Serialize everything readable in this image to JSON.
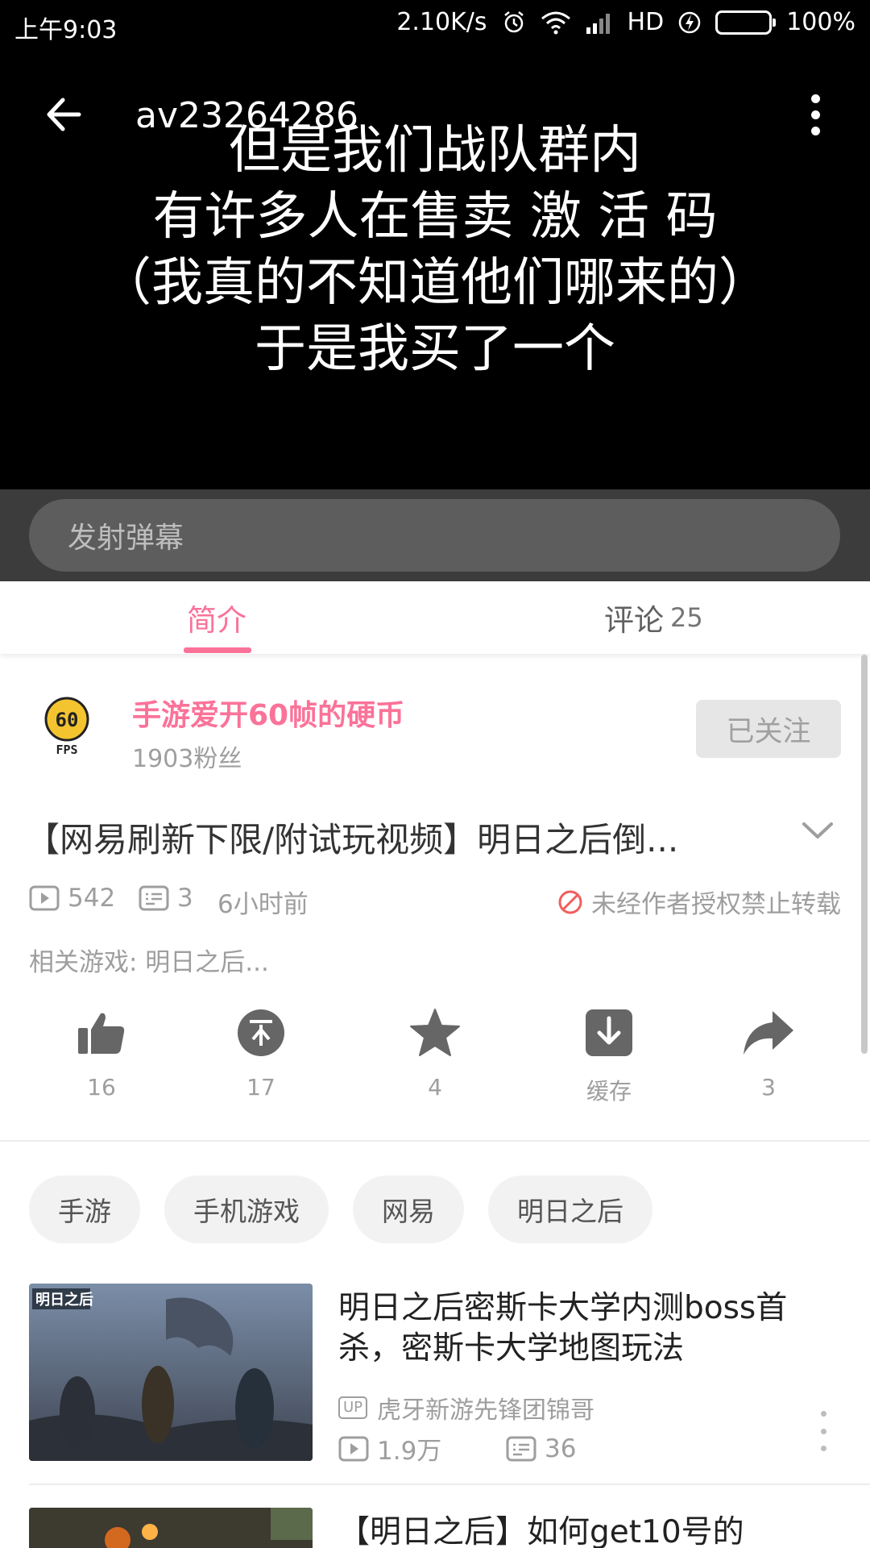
{
  "status_bar": {
    "time": "上午9:03",
    "net_speed": "2.10K/s",
    "network": "HD",
    "battery": "100%"
  },
  "player": {
    "video_id": "av23264286",
    "subtitle_lines": [
      "但是我们战队群内",
      "有许多人在售卖 激 活 码",
      "（我真的不知道他们哪来的）",
      "于是我买了一个"
    ],
    "danmaku_placeholder": "发射弹幕"
  },
  "tabs": {
    "intro": "简介",
    "comments": "评论",
    "comments_count": "25",
    "active": "intro",
    "accent": "#fb7299"
  },
  "uploader": {
    "avatar_text": "60",
    "avatar_sub": "FPS",
    "name": "手游爱开60帧的硬币",
    "fans": "1903粉丝",
    "follow_label": "已关注"
  },
  "video": {
    "title": "【网易刷新下限/附试玩视频】明日之后倒...",
    "plays": "542",
    "danmaku": "3",
    "posted": "6小时前",
    "no_repost": "未经作者授权禁止转载",
    "related_game": "相关游戏: 明日之后..."
  },
  "actions": [
    {
      "icon": "thumbs-up-icon",
      "label": "16"
    },
    {
      "icon": "coin-icon",
      "label": "17"
    },
    {
      "icon": "star-icon",
      "label": "4"
    },
    {
      "icon": "download-icon",
      "label": "缓存"
    },
    {
      "icon": "share-icon",
      "label": "3"
    }
  ],
  "tags": [
    "手游",
    "手机游戏",
    "网易",
    "明日之后"
  ],
  "recommended": [
    {
      "title": "明日之后密斯卡大学内测boss首杀，密斯卡大学地图玩法",
      "thumb_text": "明日之后",
      "up_badge": "UP",
      "uploader": "虎牙新游先锋团锦哥",
      "plays": "1.9万",
      "danmaku": "36"
    },
    {
      "title": "【明日之后】如何get10号的"
    }
  ]
}
